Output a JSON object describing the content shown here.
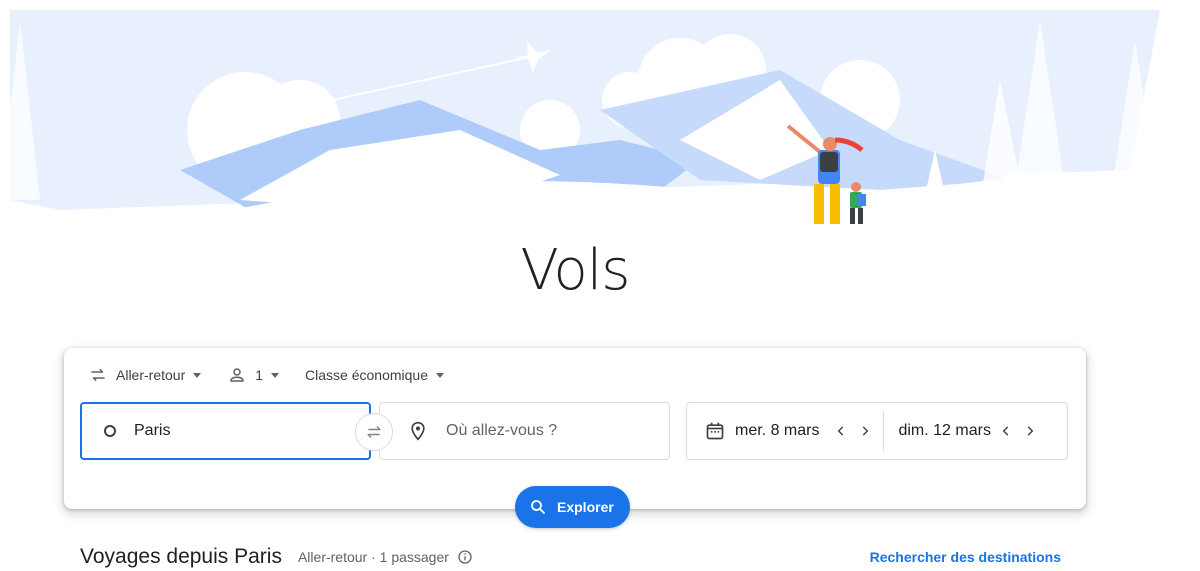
{
  "page_title": "Vols",
  "trip_options": {
    "trip_type": "Aller-retour",
    "passengers": "1",
    "cabin_class": "Classe économique"
  },
  "search": {
    "origin_value": "Paris",
    "destination_placeholder": "Où allez-vous ?",
    "departure_date": "mer. 8 mars",
    "return_date": "dim. 12 mars"
  },
  "explore_label": "Explorer",
  "trips_section": {
    "title": "Voyages depuis Paris",
    "meta": "Aller-retour · 1 passager",
    "link": "Rechercher des destinations"
  },
  "colors": {
    "accent": "#1a73e8",
    "hero_light": "#e8f0fe",
    "hero_mid": "#aecbfa"
  },
  "icons": [
    "swap-arrows-icon",
    "person-icon",
    "circle-origin-icon",
    "swap-icon",
    "location-pin-icon",
    "calendar-icon",
    "chevron-left-icon",
    "chevron-right-icon",
    "search-icon",
    "info-icon"
  ]
}
